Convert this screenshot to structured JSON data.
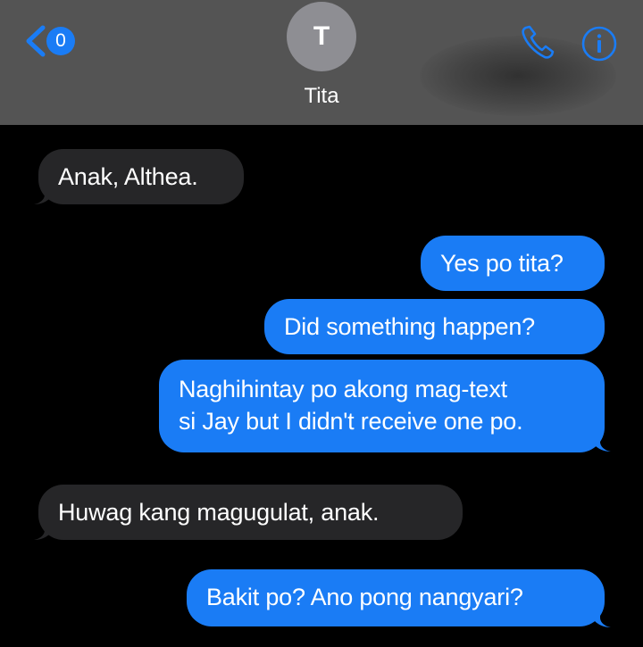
{
  "header": {
    "back_badge_count": "0",
    "avatar_initial": "T",
    "contact_name": "Tita"
  },
  "messages": [
    {
      "direction": "received",
      "text": "Anak, Althea."
    },
    {
      "direction": "sent",
      "text": "Yes po tita?"
    },
    {
      "direction": "sent",
      "text": "Did something happen?"
    },
    {
      "direction": "sent",
      "lines": [
        "Naghihintay po akong mag-text",
        "si Jay but I didn't receive one po."
      ]
    },
    {
      "direction": "received",
      "text": "Huwag kang magugulat, anak."
    },
    {
      "direction": "sent",
      "text": "Bakit po? Ano pong nangyari?"
    }
  ],
  "colors": {
    "header_bg": "#545454",
    "accent": "#1a7cf5",
    "sent_bubble": "#1a7cf5",
    "received_bubble": "#262628",
    "background": "#000000"
  },
  "icons": [
    "chevron-left-icon",
    "phone-icon",
    "info-icon"
  ]
}
